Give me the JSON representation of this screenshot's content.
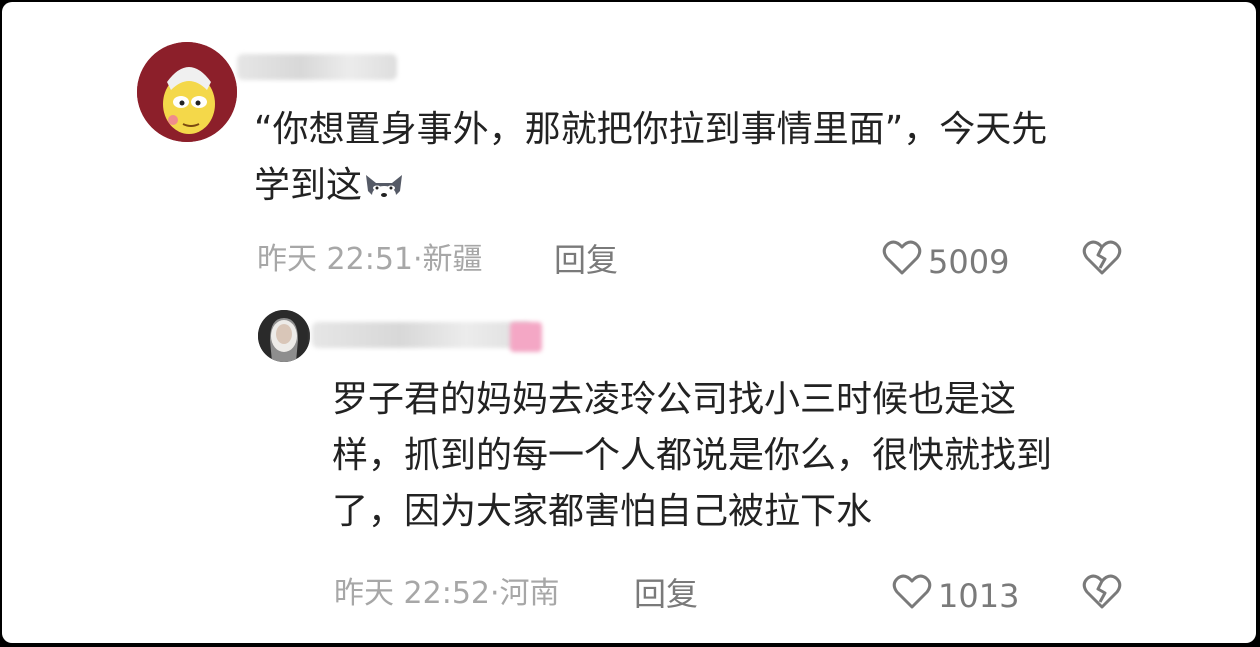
{
  "comments": [
    {
      "text_line1": "“你想置身事外，那就把你拉到事情里面”，今天先",
      "text_line2": "学到这",
      "time": "昨天 22:51",
      "location": "新疆",
      "reply_label": "回复",
      "likes": "5009",
      "avatar_icon": "cartoon-avatar",
      "emoji_icon": "husky-emoji"
    },
    {
      "text_lines": [
        "罗子君的妈妈去凌玲公司找小三时候也是这",
        "样，抓到的每一个人都说是你么，很快就找到",
        "了，因为大家都害怕自己被拉下水"
      ],
      "time": "昨天 22:52",
      "location": "河南",
      "reply_label": "回复",
      "likes": "1013",
      "avatar_icon": "user-photo-avatar"
    }
  ],
  "icons": {
    "like": "heart-outline-icon",
    "dislike": "broken-heart-icon"
  },
  "colors": {
    "text": "#222222",
    "meta": "#a7a7a7",
    "action": "#7a7a7a"
  }
}
